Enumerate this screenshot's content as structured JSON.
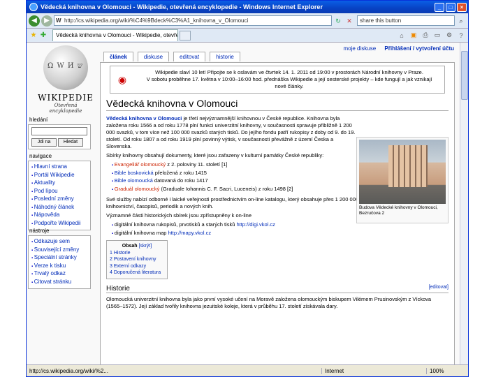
{
  "window": {
    "title": "Vědecká knihovna v Olomouci - Wikipedie, otevřená encyklopedie - Windows Internet Explorer"
  },
  "address": {
    "url": "http://cs.wikipedia.org/wiki/%C4%9Bdeck%C3%A1_knihovna_v_Olomouci",
    "search": "share this button"
  },
  "tabs": {
    "active": "Vědecká knihovna v Olomouci - Wikipedie, otevřená en..."
  },
  "wiki": {
    "name": "WIKIPEDIE",
    "slogan": "Otevřená encyklopedie",
    "content_tabs": [
      "článek",
      "diskuse",
      "editovat",
      "historie"
    ],
    "personal": {
      "talk": "moje diskuse",
      "login": "Přihlášení / vytvoření účtu"
    }
  },
  "sidebar": {
    "search_label": "hledání",
    "search_go": "Jdi na",
    "search_find": "Hledat",
    "nav_label": "navigace",
    "nav_items": [
      "Hlavní strana",
      "Portál Wikipedie",
      "Aktuality",
      "Pod lípou",
      "Poslední změny",
      "Náhodný článek",
      "Nápověda",
      "Podpořte Wikipedii"
    ],
    "tools_label": "nástroje",
    "tools_items": [
      "Odkazuje sem",
      "Související změny",
      "Speciální stránky",
      "Verze k tisku",
      "Trvalý odkaz",
      "Citovat stránku"
    ]
  },
  "notice": {
    "text1": "Wikipedie slaví 10 let! Připojte se k oslavám ve čtvrtek 14. 1. 2011 od 19:00 v prostorách Národní knihovny v Praze.",
    "text2": "V sobotu proběhne 17. května v 10:00–16:00 hod. přednáška Wikipedie a její sesterské projekty – kde fungují a jak vznikají",
    "text3": "nové články."
  },
  "article": {
    "title": "Vědecká knihovna v Olomouci",
    "intro_link": "Vědecká knihovna v Olomouci",
    "intro": " je třetí nejvýznamnější knihovnou v České republice. Knihovna byla založena roku 1566 a od roku 1778 plní funkci univerzitní knihovny, v současnosti spravuje přibližně 1 200 000 svazků, v tom více než 100 000 svazků starých tisků. Do jejího fondu patří rukopisy z doby od 9. do 19. století. Od roku 1807 a od roku 1919 plní povinný výtisk, v současnosti převážně z území Česka a Slovenska.",
    "list_intro": "Sbírky knihovny obsahují dokumenty, které jsou zařazeny v kulturní památky České republiky:",
    "bullets": [
      {
        "link": "Evangeliář olomoucký",
        "text": " z 2. poloviny 11. století [1]"
      },
      {
        "link": "Bible boskovická",
        "text": " přeložená z roku 1415"
      },
      {
        "link": "Bible olomoucká",
        "text": " datovaná do roku 1417"
      },
      {
        "link": "Graduál olomoucký",
        "text": " (Graduale Iohannis C. F. Sacri, Luceneis) z roku 1498 [2]"
      }
    ],
    "para2": "Své služby nabízí odborné i laické veřejnosti prostřednictvím on-line katalogu, který obsahuje přes 1 200 000 záznamů, v oblasti regionálního knihovnictví, časopisů, periodik a nových knih.",
    "para3": "Významné části historických sbírek jsou zpřístupněny k on-line",
    "digi": [
      {
        "text": "digitální knihovna rukopisů, prvotisků a starých tisků ",
        "link": "http://digi.vkol.cz"
      },
      {
        "text": "digitální knihovna map ",
        "link": "http://mapy.vkol.cz"
      }
    ],
    "photo_caption": "Budova Vědecké knihovny v Olomouci, Bezručova 2",
    "toc": {
      "title": "Obsah",
      "toggle": "[skrýt]",
      "items": [
        "1 Historie",
        "2 Postavení knihovny",
        "3 Externí odkazy",
        "4 Doporučená literatura"
      ]
    },
    "section": "Historie",
    "section_edit": "[editovat]",
    "history": "Olomoucká univerzitní knihovna byla jako první vysoké učení na Moravě založena olomouckým biskupem Vilémem Prusinovským z Víckova (1565–1572). Její základ tvořily knihovna jezuitské koleje, která v průběhu 17. století získávala dary."
  },
  "status": {
    "url": "http://cs.wikipedia.org/wiki/%2...",
    "zone": "Internet",
    "zoom": "100%"
  }
}
